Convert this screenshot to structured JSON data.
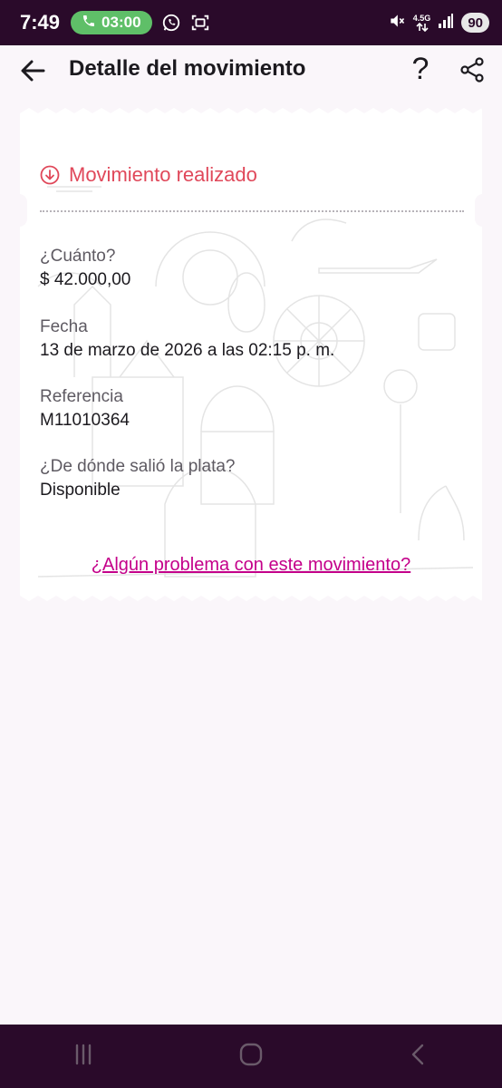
{
  "status_bar": {
    "time": "7:49",
    "call_duration": "03:00",
    "network_label": "4.5G",
    "battery": "90",
    "icons": [
      "phone-icon",
      "whatsapp-icon",
      "screen-record-icon",
      "mute-icon",
      "network-arrows-icon",
      "signal-icon"
    ]
  },
  "header": {
    "title": "Detalle del movimiento",
    "help_label": "?",
    "icons": [
      "back-arrow-icon",
      "help-icon",
      "share-icon"
    ]
  },
  "receipt": {
    "status_text": "Movimiento realizado",
    "status_color": "#e0485a",
    "fields": [
      {
        "label": "¿Cuánto?",
        "value": "$ 42.000,00"
      },
      {
        "label": "Fecha",
        "value": "13 de marzo de 2026 a las 02:15 p. m."
      },
      {
        "label": "Referencia",
        "value": "M11010364"
      },
      {
        "label": "¿De dónde salió la plata?",
        "value": "Disponible"
      }
    ],
    "problem_link": "¿Algún problema con este movimiento?",
    "link_color": "#c4008a"
  },
  "nav_bar": {
    "icons": [
      "recent-apps-icon",
      "home-icon",
      "back-icon"
    ]
  }
}
